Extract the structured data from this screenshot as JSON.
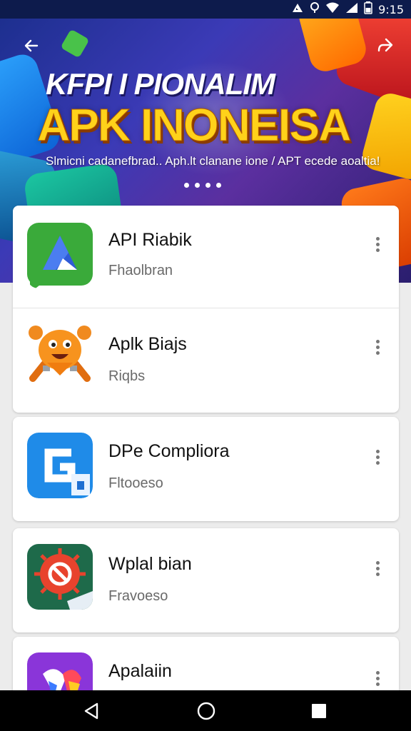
{
  "status_bar": {
    "time": "9:15"
  },
  "hero": {
    "title": "KFPI I PIONALIM",
    "headline": "APK INONEISA",
    "subtitle": "Slmicni cadanefbrad.. Aph.lt clanane ione / APT ecede aoaltia!",
    "page_count": 4
  },
  "apps": [
    {
      "name": "API Riabik",
      "subtitle": "Fhaolbran",
      "icon": "green-triangle-chat-icon"
    },
    {
      "name": "Aplk Biajs",
      "subtitle": "Riqbs",
      "icon": "orange-monster-icon"
    },
    {
      "name": "DPe Compliora",
      "subtitle": "Fltooeso",
      "icon": "blue-g-icon"
    },
    {
      "name": "Wplal bian",
      "subtitle": "Fravoeso",
      "icon": "red-blocked-icon"
    },
    {
      "name": "Apalaiin",
      "subtitle": "",
      "icon": "purple-ribbon-icon"
    }
  ],
  "colors": {
    "hero_accent": "#ffd21a",
    "status_bar": "#0d1b4c",
    "list_background": "#ececec"
  }
}
